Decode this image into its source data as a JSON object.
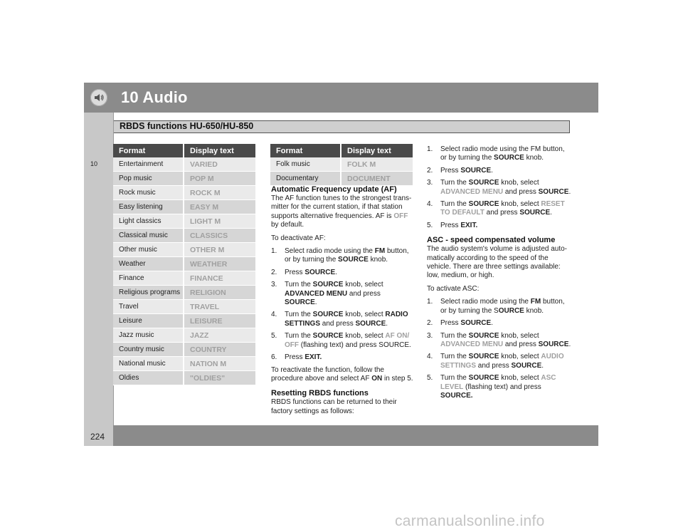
{
  "header": {
    "chapter_title": "10 Audio",
    "section_title": "RBDS functions HU-650/HU-850",
    "side_chapter_number": "10",
    "page_number": "224"
  },
  "table1": {
    "col1_header": "Format",
    "col2_header": "Display text",
    "rows": [
      {
        "format": "Entertainment",
        "display": "VARIED"
      },
      {
        "format": "Pop music",
        "display": "POP M"
      },
      {
        "format": "Rock music",
        "display": "ROCK M"
      },
      {
        "format": "Easy listening",
        "display": "EASY M"
      },
      {
        "format": "Light classics",
        "display": "LIGHT M"
      },
      {
        "format": "Classical music",
        "display": "CLASSICS"
      },
      {
        "format": "Other music",
        "display": "OTHER M"
      },
      {
        "format": "Weather",
        "display": "WEATHER"
      },
      {
        "format": "Finance",
        "display": "FINANCE"
      },
      {
        "format": "Religious programs",
        "display": "RELIGION"
      },
      {
        "format": "Travel",
        "display": "TRAVEL"
      },
      {
        "format": "Leisure",
        "display": "LEISURE"
      },
      {
        "format": "Jazz music",
        "display": "JAZZ"
      },
      {
        "format": "Country music",
        "display": "COUNTRY"
      },
      {
        "format": "National music",
        "display": "NATION M"
      },
      {
        "format": "Oldies",
        "display": "\"OLDIES\""
      }
    ]
  },
  "table2": {
    "col1_header": "Format",
    "col2_header": "Display text",
    "rows": [
      {
        "format": "Folk music",
        "display": "FOLK M"
      },
      {
        "format": "Documentary",
        "display": "DOCUMENT"
      }
    ]
  },
  "af": {
    "heading": "Automatic Frequency update (AF)",
    "intro_a": "The AF function tunes to the strongest trans-mitter for the current station, if that station supports alternative frequencies. AF is ",
    "intro_off": "OFF",
    "intro_b": " by default.",
    "deactivate": "To deactivate AF:",
    "s1_a": "Select radio mode using the ",
    "s1_fm": "FM",
    "s1_b": " button, or by turning the ",
    "s1_source": "SOURCE",
    "s1_c": " knob.",
    "s2_a": "Press ",
    "s2_source": "SOURCE",
    "s2_b": ".",
    "s3_a": "Turn the ",
    "s3_source": "SOURCE",
    "s3_b": " knob, select ",
    "s3_menu": "ADVANCED MENU",
    "s3_c": " and press ",
    "s3_source2": "SOURCE",
    "s3_d": ".",
    "s4_a": "Turn the ",
    "s4_source": "SOURCE",
    "s4_b": " knob, select ",
    "s4_radio": "RADIO SETTINGS",
    "s4_c": " and press ",
    "s4_source2": "SOURCE",
    "s4_d": ".",
    "s5_a": "Turn the ",
    "s5_source": "SOURCE",
    "s5_b": " knob, select ",
    "s5_afon": "AF ON/ OFF",
    "s5_c": " (flashing text) and press SOURCE.",
    "s6_a": "Press ",
    "s6_exit": "EXIT.",
    "reactivate_a": "To reactivate the function, follow the procedure above and select AF ",
    "reactivate_on": "ON",
    "reactivate_b": " in step 5."
  },
  "reset": {
    "heading": "Resetting RBDS functions",
    "intro": "RBDS functions can be returned to their factory settings as follows:",
    "s1": "Select radio mode using the FM button, or by turning the ",
    "s1_source": "SOURCE",
    "s1_b": " knob.",
    "s2_a": "Press ",
    "s2_source": "SOURCE",
    "s2_b": ".",
    "s3_a": "Turn the ",
    "s3_source": "SOURCE",
    "s3_b": " knob, select ",
    "s3_menu": "ADVANCED MENU",
    "s3_c": " and press ",
    "s3_source2": "SOURCE",
    "s3_d": ".",
    "s4_a": "Turn the ",
    "s4_source": "SOURCE",
    "s4_b": " knob, select ",
    "s4_reset": "RESET TO DEFAULT",
    "s4_c": " and press ",
    "s4_source2": "SOURCE",
    "s4_d": ".",
    "s5_a": "Press ",
    "s5_exit": "EXIT."
  },
  "asc": {
    "heading": "ASC - speed compensated volume",
    "intro": "The audio system's volume is adjusted auto-matically according to the speed of the vehicle. There are three settings available: low, medium, or high.",
    "activate": "To activate ASC:",
    "s1_a": "Select radio mode using the ",
    "s1_fm": "FM",
    "s1_b": " button, or by turning the S",
    "s1_ource": "OURCE",
    "s1_c": " knob.",
    "s2_a": "Press ",
    "s2_source": "SOURCE",
    "s2_b": ".",
    "s3_a": "Turn the ",
    "s3_source": "SOURCE",
    "s3_b": " knob, select ",
    "s3_menu": "ADVANCED MENU",
    "s3_c": " and press ",
    "s3_source2": "SOURCE",
    "s3_d": ".",
    "s4_a": "Turn the ",
    "s4_source": "SOURCE",
    "s4_b": " knob, select ",
    "s4_audio": "AUDIO SETTINGS",
    "s4_c": " and press ",
    "s4_source2": "SOURCE",
    "s4_d": ".",
    "s5_a": "Turn the ",
    "s5_source": "SOURCE",
    "s5_b": " knob, select ",
    "s5_asc": "ASC LEVEL",
    "s5_c": " (flashing text) and press ",
    "s5_source2": "SOURCE."
  },
  "numbers": [
    "1.",
    "2.",
    "3.",
    "4.",
    "5.",
    "6."
  ],
  "watermark": "carmanualsonline.info",
  "colors": {
    "header_bar": "#8b8b8b",
    "table_header": "#4a4a4a",
    "highlight_text": "#a0a0a0"
  }
}
